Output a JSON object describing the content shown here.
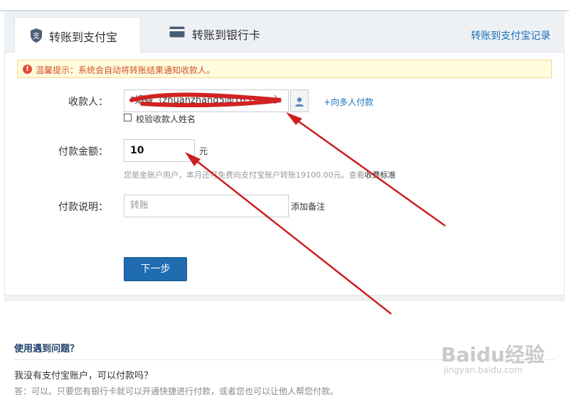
{
  "tabs": [
    {
      "label": "转账到支付宝",
      "active": true,
      "icon": "alipay-shield-icon"
    },
    {
      "label": "转账到银行卡",
      "active": false,
      "icon": "bank-card-icon"
    }
  ],
  "header": {
    "record_link": "转账到支付宝记录"
  },
  "notice": {
    "text": "温馨提示：系统会自动将转账结果通知收款人。"
  },
  "form": {
    "payee_label": "收款人：",
    "payee_value": "*娟香（zhuanzhang5@163.com）",
    "multi_pay_link": "+向多人付款",
    "verify_name_label": "校验收款人姓名",
    "verify_name_checked": false,
    "amount_label": "付款金额：",
    "amount_value": "10",
    "amount_unit": "元",
    "amount_tip": "您是金账户用户，本月还可免费向支付宝账户转账19100.00元。查看",
    "fee_link": "收费标准",
    "desc_label": "付款说明：",
    "desc_placeholder": "转账",
    "add_note": "添加备注",
    "next_button": "下一步"
  },
  "help": {
    "title": "使用遇到问题？",
    "question": "我没有支付宝账户，可以付款吗？",
    "answer": "答：可以。只要您有银行卡就可以开通快捷进行付款，或者您也可以让他人帮您付款。"
  },
  "watermark": {
    "logo": "Baidu经验",
    "url": "jingyan.baidu.com"
  },
  "colors": {
    "accent": "#1f6cb0",
    "link": "#1a6fb8",
    "notice_text": "#d0552c",
    "annotation": "#cc1f1f"
  }
}
